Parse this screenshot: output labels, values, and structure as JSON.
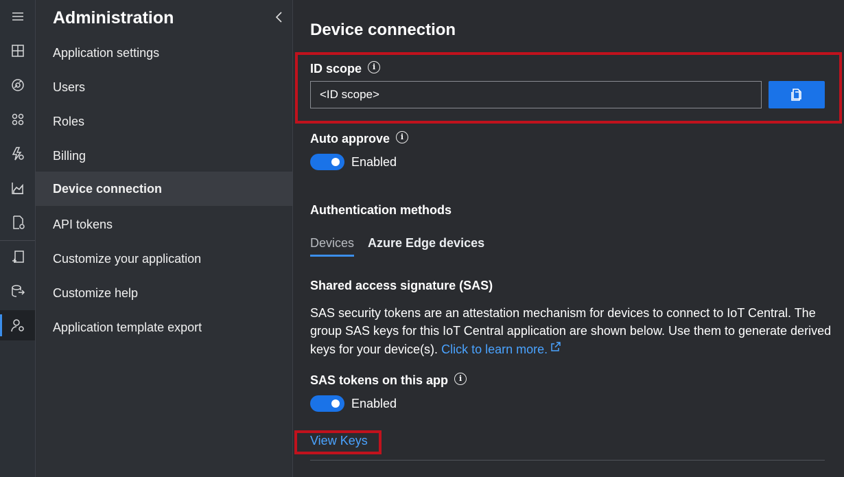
{
  "rail": {
    "icons": [
      "menu-icon",
      "dashboard-icon",
      "devices-icon",
      "device-groups-icon",
      "rules-icon",
      "analytics-icon",
      "jobs-icon",
      "device-templates-icon",
      "data-export-icon",
      "administration-icon"
    ]
  },
  "nav": {
    "title": "Administration",
    "items": [
      {
        "label": "Application settings"
      },
      {
        "label": "Users"
      },
      {
        "label": "Roles"
      },
      {
        "label": "Billing"
      },
      {
        "label": "Device connection"
      },
      {
        "label": "API tokens"
      },
      {
        "label": "Customize your application"
      },
      {
        "label": "Customize help"
      },
      {
        "label": "Application template export"
      }
    ],
    "selected": "Device connection"
  },
  "main": {
    "title": "Device connection",
    "id_scope": {
      "label": "ID scope",
      "value": "<ID scope>"
    },
    "auto_approve": {
      "label": "Auto approve",
      "status": "Enabled"
    },
    "auth_methods": {
      "heading": "Authentication methods",
      "tabs": [
        {
          "label": "Devices"
        },
        {
          "label": "Azure Edge devices"
        }
      ]
    },
    "sas": {
      "heading": "Shared access signature (SAS)",
      "description": "SAS security tokens are an attestation mechanism for devices to connect to IoT Central. The group SAS keys for this IoT Central application are shown below. Use them to generate derived keys for your device(s).",
      "learn_more": "Click to learn more.",
      "tokens_label": "SAS tokens on this app",
      "tokens_status": "Enabled"
    },
    "view_keys": "View Keys"
  },
  "colors": {
    "accent": "#1a73e8",
    "link": "#4aa3ff",
    "highlight": "#c0121d"
  }
}
